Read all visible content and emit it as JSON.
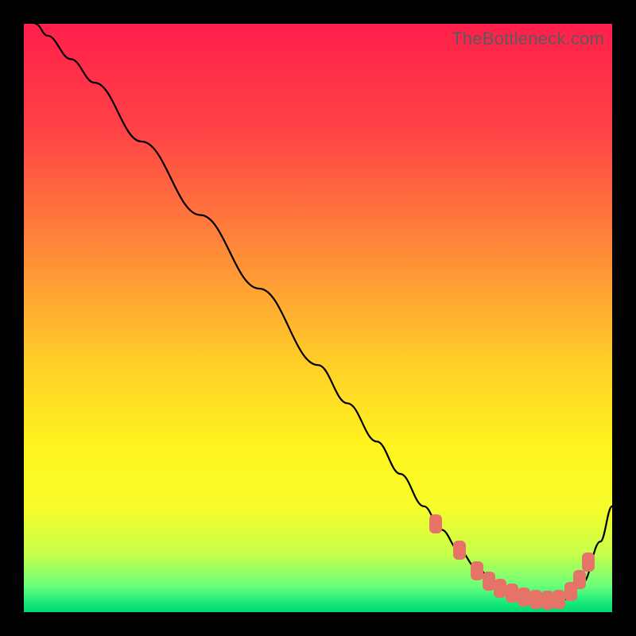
{
  "watermark": "TheBottleneck.com",
  "chart_data": {
    "type": "line",
    "title": "",
    "xlabel": "",
    "ylabel": "",
    "xlim": [
      0,
      100
    ],
    "ylim": [
      0,
      100
    ],
    "series": [
      {
        "name": "bottleneck-curve",
        "x": [
          2,
          4,
          8,
          12,
          20,
          30,
          40,
          50,
          55,
          60,
          64,
          68,
          71,
          74,
          77,
          80,
          83,
          86,
          89,
          92,
          95,
          98,
          100
        ],
        "y": [
          100,
          98,
          94,
          90,
          80,
          67.5,
          55,
          42,
          35.5,
          29,
          23.5,
          18,
          14,
          10.5,
          7.5,
          5,
          3.2,
          2.2,
          2,
          2.2,
          5,
          12,
          18
        ]
      }
    ],
    "highlight_points": {
      "name": "optimal-range-dots",
      "x": [
        70,
        74,
        77,
        79,
        81,
        83,
        85,
        87,
        89,
        91,
        93,
        94.5,
        96
      ],
      "y": [
        15,
        10.5,
        7,
        5.3,
        4,
        3.2,
        2.6,
        2.2,
        2,
        2.2,
        3.5,
        5.5,
        8.5
      ]
    },
    "background_gradient": {
      "stops": [
        {
          "pos": 0.0,
          "color": "#ff1f4b"
        },
        {
          "pos": 0.18,
          "color": "#ff4246"
        },
        {
          "pos": 0.4,
          "color": "#ff8f38"
        },
        {
          "pos": 0.58,
          "color": "#ffd028"
        },
        {
          "pos": 0.72,
          "color": "#fff41e"
        },
        {
          "pos": 0.82,
          "color": "#f7fc2a"
        },
        {
          "pos": 0.9,
          "color": "#c8ff4a"
        },
        {
          "pos": 0.955,
          "color": "#6bff7a"
        },
        {
          "pos": 0.985,
          "color": "#16e87a"
        },
        {
          "pos": 1.0,
          "color": "#00d870"
        }
      ]
    }
  }
}
